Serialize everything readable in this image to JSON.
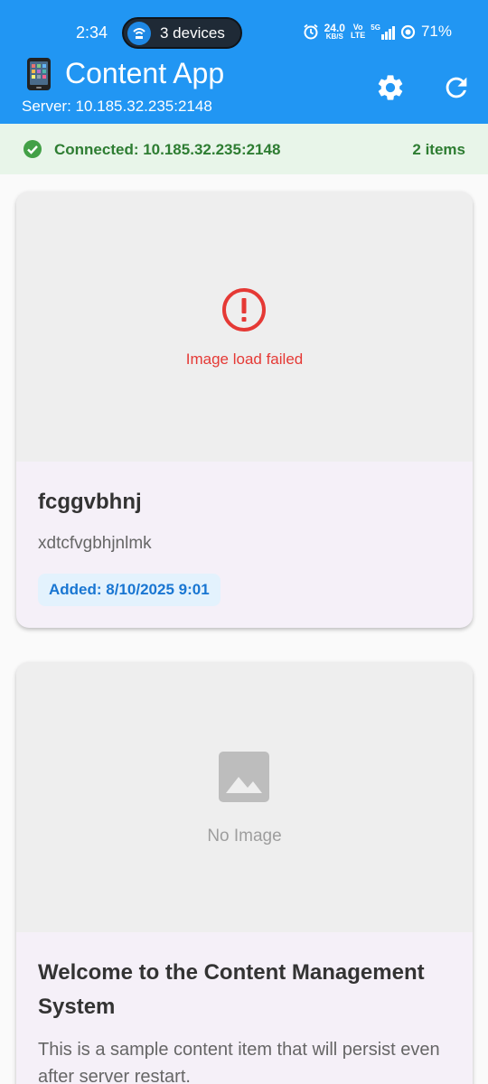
{
  "status_bar": {
    "time": "2:34",
    "devices_label": "3 devices",
    "net_speed_value": "24.0",
    "net_speed_unit": "KB/S",
    "volte_top": "Vo",
    "volte_bottom": "LTE",
    "signal_label": "5G",
    "battery": "71%"
  },
  "app_bar": {
    "title": "Content App",
    "subtitle": "Server: 10.185.32.235:2148",
    "settings_icon": "gear-icon",
    "refresh_icon": "refresh-icon"
  },
  "connection": {
    "status_text": "Connected: 10.185.32.235:2148",
    "item_count": "2 items",
    "color": "#2e7d32"
  },
  "items": [
    {
      "image_state": "Image load failed",
      "title": "fcggvbhnj",
      "description": "xdtcfvgbhjnlmk",
      "added": "Added: 8/10/2025 9:01"
    },
    {
      "image_state": "No Image",
      "title": "Welcome to the Content Management System",
      "description": "This is a sample content item that will persist even after server restart."
    }
  ],
  "colors": {
    "primary": "#2196f3",
    "error": "#e53935",
    "badge_text": "#1976d2",
    "badge_bg": "#e3f2fd"
  }
}
